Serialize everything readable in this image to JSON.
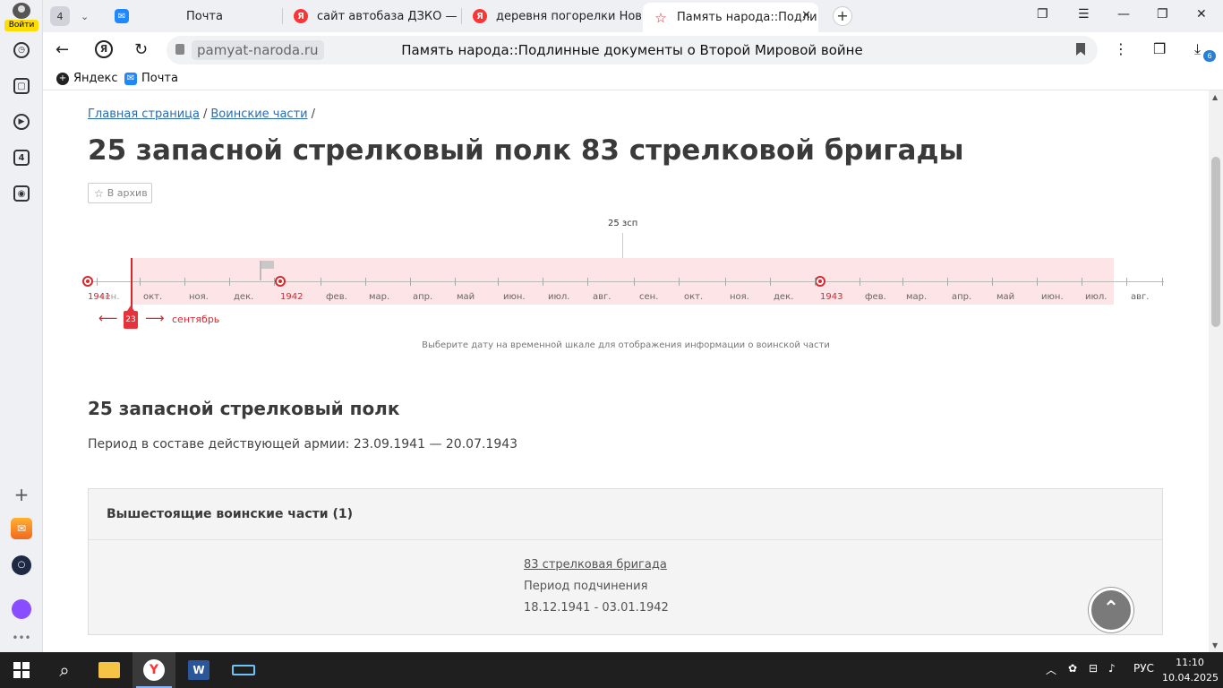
{
  "sidebar": {
    "login_label": "Войти",
    "tab_count_badge": "4"
  },
  "tabs": {
    "counter": "4",
    "items": [
      {
        "title": "Почта",
        "icon": "mail-icon"
      },
      {
        "title": "сайт автобаза ДЗКО — Ян",
        "icon": "yandex-icon"
      },
      {
        "title": "деревня погорелки Ново",
        "icon": "yandex-icon"
      },
      {
        "title": "Память народа::Подли",
        "icon": "star-icon",
        "active": true
      }
    ]
  },
  "toolbar": {
    "domain": "pamyat-naroda.ru",
    "page_title": "Память народа::Подлинные документы о Второй Мировой войне",
    "downloads_badge": "6"
  },
  "bookmarks": [
    {
      "label": "Яндекс"
    },
    {
      "label": "Почта"
    }
  ],
  "page": {
    "breadcrumbs": [
      "Главная страница",
      "Воинские части"
    ],
    "title": "25 запасной стрелковый полк 83 стрелковой бригады",
    "archive_button": "В архив",
    "timeline": {
      "unit_label": "25 зсп",
      "months_1941": [
        "сен.",
        "окт.",
        "ноя.",
        "дек."
      ],
      "year_1941": "1941",
      "year_1942": "1942",
      "months_1942": [
        "фев.",
        "мар.",
        "апр.",
        "май",
        "июн.",
        "июл.",
        "авг.",
        "сен.",
        "окт.",
        "ноя.",
        "дек."
      ],
      "year_1943": "1943",
      "months_1943": [
        "фев.",
        "мар.",
        "апр.",
        "май",
        "июн.",
        "июл.",
        "авг."
      ],
      "cursor_day": "23",
      "cursor_month": "сентябрь",
      "hint": "Выберите дату на временной шкале для отображения информации о воинской части"
    },
    "unit_heading": "25 запасной стрелковый полк",
    "period_text": "Период в составе действующей армии: 23.09.1941 — 20.07.1943",
    "superior": {
      "heading": "Вышестоящие воинские части (1)",
      "unit_link": "83 стрелковая бригада",
      "period_label": "Период подчинения",
      "period_dates": "18.12.1941 - 03.01.1942"
    }
  },
  "taskbar": {
    "language": "РУС",
    "time": "11:10",
    "date": "10.04.2025"
  },
  "colors": {
    "accent_red": "#d9272e",
    "timeline_band": "#fde4e6",
    "link_blue": "#2b6cb0"
  }
}
